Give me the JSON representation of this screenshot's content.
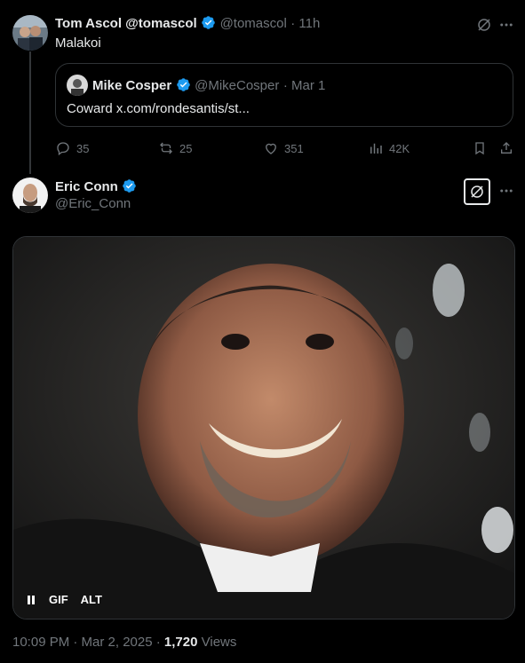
{
  "tweet1": {
    "display_name": "Tom Ascol @tomascol",
    "handle": "@tomascol",
    "time": "· 11h",
    "text": "Malakoi",
    "quote": {
      "display_name": "Mike Cosper",
      "handle": "@MikeCosper",
      "time": "· Mar 1",
      "text": "Coward x.com/rondesantis/st..."
    },
    "actions": {
      "replies": "35",
      "reposts": "25",
      "likes": "351",
      "views": "42K"
    }
  },
  "tweet2": {
    "display_name": "Eric Conn",
    "handle": "@Eric_Conn",
    "media": {
      "gif_label": "GIF",
      "alt_label": "ALT"
    },
    "footer": {
      "timestamp": "10:09 PM · Mar 2, 2025 ·",
      "views_count": "1,720",
      "views_label": "Views"
    }
  },
  "colors": {
    "background": "#000000",
    "text": "#e7e9ea",
    "muted": "#71767b",
    "verified": "#1d9bf0",
    "border": "#2f3336"
  },
  "icons": [
    "grok-icon",
    "more-icon",
    "verified-icon",
    "reply-icon",
    "repost-icon",
    "like-icon",
    "views-icon",
    "bookmark-icon",
    "share-icon",
    "pause-icon"
  ]
}
